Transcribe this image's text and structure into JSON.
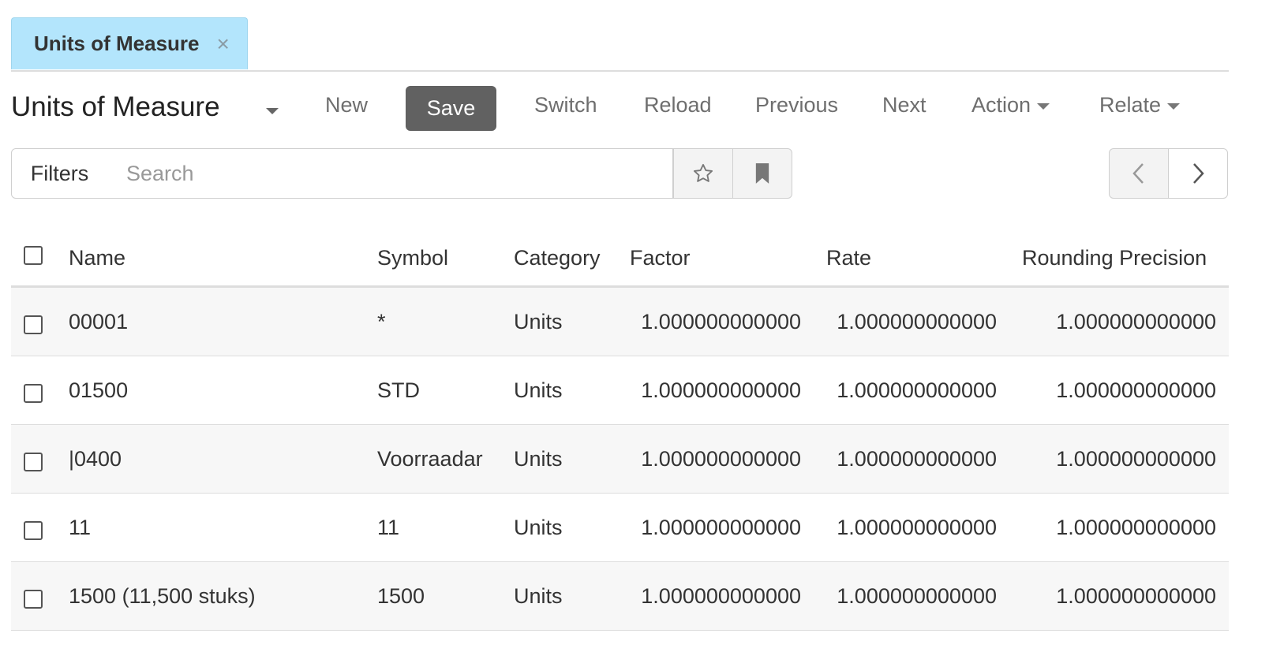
{
  "tab": {
    "label": "Units of Measure",
    "close_glyph": "×"
  },
  "toolbar": {
    "title": "Units of Measure",
    "new": "New",
    "save": "Save",
    "switch": "Switch",
    "reload": "Reload",
    "previous": "Previous",
    "next": "Next",
    "action": "Action",
    "relate": "Relate"
  },
  "filter": {
    "filters_label": "Filters",
    "search_placeholder": "Search"
  },
  "icons": {
    "star": "star-outline-icon",
    "bookmark": "bookmark-icon",
    "prev": "chevron-left-icon",
    "next": "chevron-right-icon"
  },
  "table": {
    "columns": [
      "Name",
      "Symbol",
      "Category",
      "Factor",
      "Rate",
      "Rounding Precision"
    ],
    "rows": [
      {
        "name": "00001",
        "symbol": "*",
        "category": "Units",
        "factor": "1.000000000000",
        "rate": "1.000000000000",
        "rounding": "1.000000000000"
      },
      {
        "name": "01500",
        "symbol": "STD",
        "category": "Units",
        "factor": "1.000000000000",
        "rate": "1.000000000000",
        "rounding": "1.000000000000"
      },
      {
        "name": "|0400",
        "symbol": "Voorraadar",
        "category": "Units",
        "factor": "1.000000000000",
        "rate": "1.000000000000",
        "rounding": "1.000000000000"
      },
      {
        "name": "11",
        "symbol": "11",
        "category": "Units",
        "factor": "1.000000000000",
        "rate": "1.000000000000",
        "rounding": "1.000000000000"
      },
      {
        "name": "1500 (11,500 stuks)",
        "symbol": "1500",
        "category": "Units",
        "factor": "1.000000000000",
        "rate": "1.000000000000",
        "rounding": "1.000000000000"
      }
    ]
  }
}
